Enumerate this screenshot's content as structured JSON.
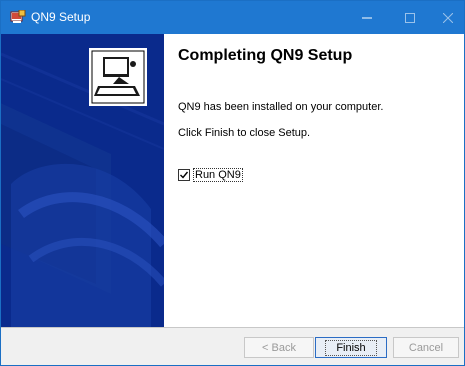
{
  "window": {
    "title": "QN9 Setup",
    "controls": {
      "minimize": "—",
      "maximize": "☐",
      "close": "✕"
    }
  },
  "content": {
    "heading": "Completing QN9 Setup",
    "line1": "QN9 has been installed on your computer.",
    "line2": "Click Finish to close Setup.",
    "run_checkbox": {
      "label": "Run QN9",
      "checked": true
    }
  },
  "footer": {
    "back_label": "< Back",
    "finish_label": "Finish",
    "cancel_label": "Cancel"
  },
  "colors": {
    "titlebar": "#1f78d1",
    "sidebar": "#0a2a8c",
    "sidebar_accent": "#1e47b3"
  },
  "icons": {
    "app": "installer-icon",
    "wizard": "computer-install-icon"
  }
}
